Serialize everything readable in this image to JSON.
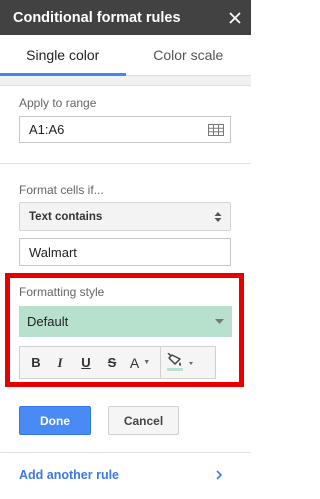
{
  "header": {
    "title": "Conditional format rules",
    "close_icon": "close-icon"
  },
  "tabs": [
    {
      "label": "Single color",
      "active": true
    },
    {
      "label": "Color scale",
      "active": false
    }
  ],
  "range": {
    "label": "Apply to range",
    "value": "A1:A6",
    "icon": "grid-icon"
  },
  "condition": {
    "label": "Format cells if...",
    "selected": "Text contains",
    "value": "Walmart"
  },
  "formatting": {
    "label": "Formatting style",
    "selected": "Default",
    "preview_color": "#b7e1cd",
    "toolbar": {
      "bold": "B",
      "italic": "I",
      "underline": "U",
      "strikethrough": "S",
      "text_color": "A",
      "fill_color_swatch": "#b7e1cd"
    }
  },
  "actions": {
    "done": "Done",
    "cancel": "Cancel",
    "done_color": "#4a8af4"
  },
  "footer": {
    "add_rule": "Add another rule"
  },
  "highlight_color": "#e60000"
}
